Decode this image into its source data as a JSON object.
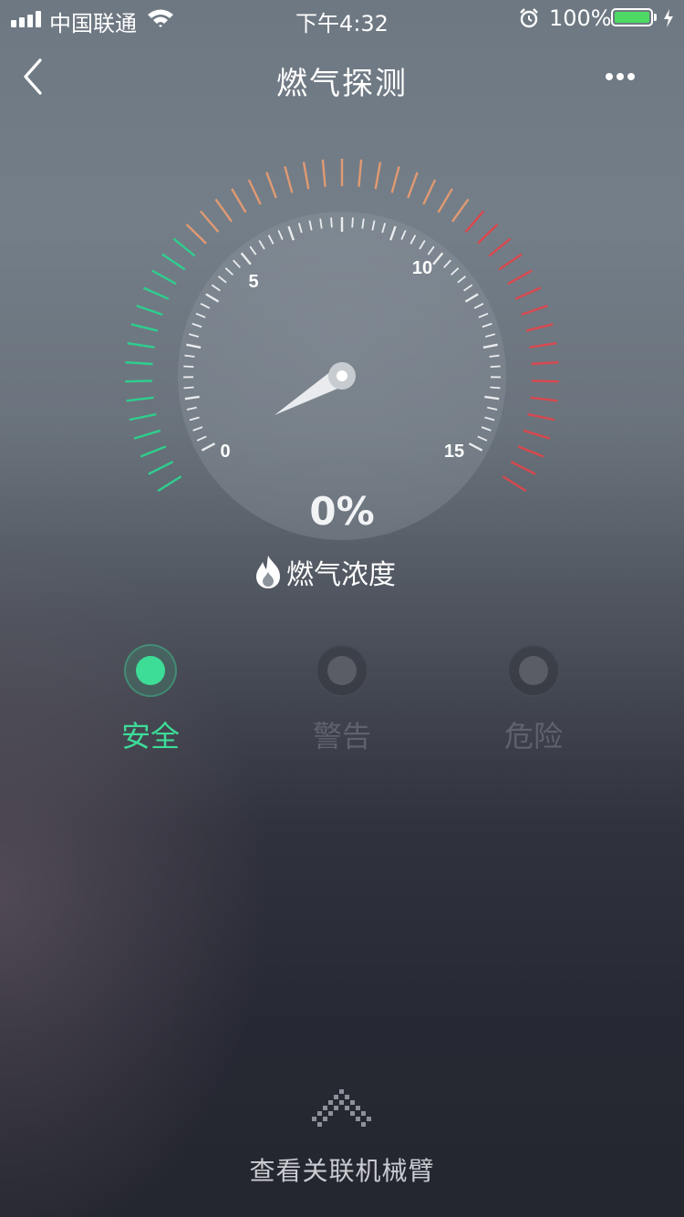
{
  "status_bar": {
    "carrier": "中国联通",
    "time": "下午4:32",
    "battery": "100%"
  },
  "nav": {
    "title": "燃气探测",
    "back_icon": "chevron-left-icon",
    "more_icon": "more-dots-icon"
  },
  "gauge": {
    "tick_labels": [
      "0",
      "5",
      "10",
      "15"
    ],
    "value": "0%",
    "label": "燃气浓度",
    "label_icon": "flame-icon",
    "colors": {
      "safe": "#2ecf8e",
      "warning": "#e09a72",
      "danger": "#d9484e"
    }
  },
  "statuses": [
    {
      "label": "安全",
      "active": true,
      "color": "#3ddc97"
    },
    {
      "label": "警告",
      "active": false,
      "color": "#5a5d66"
    },
    {
      "label": "危险",
      "active": false,
      "color": "#5a5d66"
    }
  ],
  "bottom": {
    "text": "查看关联机械臂",
    "icon": "double-chevron-up-icon"
  }
}
